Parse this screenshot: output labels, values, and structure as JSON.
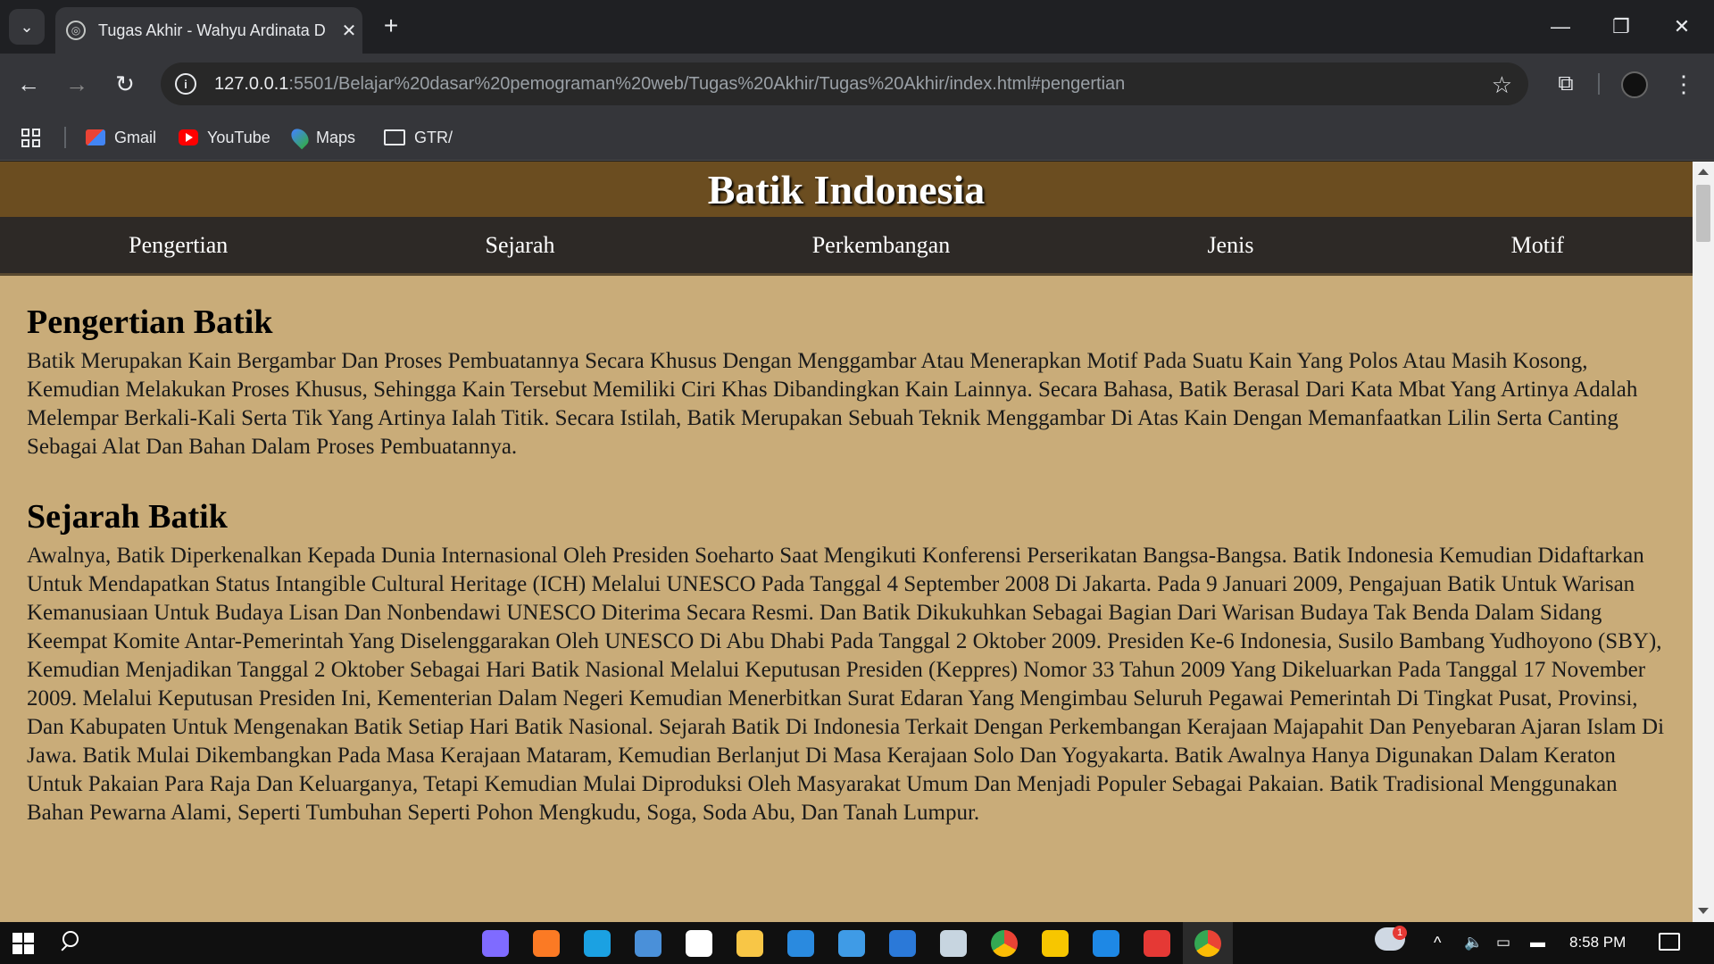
{
  "browser": {
    "tab_title": "Tugas Akhir - Wahyu Ardinata D",
    "url_host": "127.0.0.1",
    "url_path": ":5501/Belajar%20dasar%20pemograman%20web/Tugas%20Akhir/Tugas%20Akhir/index.html#pengertian",
    "bookmarks": [
      {
        "label": "Gmail",
        "icon": "gmail-icon",
        "color": "#ea4335"
      },
      {
        "label": "YouTube",
        "icon": "youtube-icon",
        "color": "#ff0000"
      },
      {
        "label": "Maps",
        "icon": "maps-icon",
        "color": "#34a853"
      },
      {
        "label": "GTR/",
        "icon": "folder-icon",
        "color": "#e8eaed"
      }
    ]
  },
  "site": {
    "title": "Batik Indonesia",
    "nav": [
      "Pengertian",
      "Sejarah",
      "Perkembangan",
      "Jenis",
      "Motif"
    ],
    "sections": [
      {
        "heading": "Pengertian Batik",
        "body": "Batik Merupakan Kain Bergambar Dan Proses Pembuatannya Secara Khusus Dengan Menggambar Atau Menerapkan Motif Pada Suatu Kain Yang Polos Atau Masih Kosong, Kemudian Melakukan Proses Khusus, Sehingga Kain Tersebut Memiliki Ciri Khas Dibandingkan Kain Lainnya. Secara Bahasa, Batik Berasal Dari Kata Mbat Yang Artinya Adalah Melempar Berkali-Kali Serta Tik Yang Artinya Ialah Titik. Secara Istilah, Batik Merupakan Sebuah Teknik Menggambar Di Atas Kain Dengan Memanfaatkan Lilin Serta Canting Sebagai Alat Dan Bahan Dalam Proses Pembuatannya."
      },
      {
        "heading": "Sejarah Batik",
        "body": "Awalnya, Batik Diperkenalkan Kepada Dunia Internasional Oleh Presiden Soeharto Saat Mengikuti Konferensi Perserikatan Bangsa-Bangsa. Batik Indonesia Kemudian Didaftarkan Untuk Mendapatkan Status Intangible Cultural Heritage (ICH) Melalui UNESCO Pada Tanggal 4 September 2008 Di Jakarta. Pada 9 Januari 2009, Pengajuan Batik Untuk Warisan Kemanusiaan Untuk Budaya Lisan Dan Nonbendawi UNESCO Diterima Secara Resmi. Dan Batik Dikukuhkan Sebagai Bagian Dari Warisan Budaya Tak Benda Dalam Sidang Keempat Komite Antar-Pemerintah Yang Diselenggarakan Oleh UNESCO Di Abu Dhabi Pada Tanggal 2 Oktober 2009. Presiden Ke-6 Indonesia, Susilo Bambang Yudhoyono (SBY), Kemudian Menjadikan Tanggal 2 Oktober Sebagai Hari Batik Nasional Melalui Keputusan Presiden (Keppres) Nomor 33 Tahun 2009 Yang Dikeluarkan Pada Tanggal 17 November 2009. Melalui Keputusan Presiden Ini, Kementerian Dalam Negeri Kemudian Menerbitkan Surat Edaran Yang Mengimbau Seluruh Pegawai Pemerintah Di Tingkat Pusat, Provinsi, Dan Kabupaten Untuk Mengenakan Batik Setiap Hari Batik Nasional. Sejarah Batik Di Indonesia Terkait Dengan Perkembangan Kerajaan Majapahit Dan Penyebaran Ajaran Islam Di Jawa. Batik Mulai Dikembangkan Pada Masa Kerajaan Mataram, Kemudian Berlanjut Di Masa Kerajaan Solo Dan Yogyakarta. Batik Awalnya Hanya Digunakan Dalam Keraton Untuk Pakaian Para Raja Dan Keluarganya, Tetapi Kemudian Mulai Diproduksi Oleh Masyarakat Umum Dan Menjadi Populer Sebagai Pakaian. Batik Tradisional Menggunakan Bahan Pewarna Alami, Seperti Tumbuhan Seperti Pohon Mengkudu, Soga, Soda Abu, Dan Tanah Lumpur."
      }
    ]
  },
  "taskbar": {
    "time": "8:58 PM",
    "weather_badge": "1",
    "apps": [
      {
        "name": "copilot-icon",
        "color": "#7f6bff"
      },
      {
        "name": "xampp-icon",
        "color": "#fb7a24"
      },
      {
        "name": "edge-icon",
        "color": "#1ba1e2"
      },
      {
        "name": "sublime-icon",
        "color": "#4a90d9"
      },
      {
        "name": "capcut-icon",
        "color": "#ffffff"
      },
      {
        "name": "file-explorer-icon",
        "color": "#f8c646"
      },
      {
        "name": "vscode-icon",
        "color": "#2a8adf"
      },
      {
        "name": "paint-icon",
        "color": "#3f9be6"
      },
      {
        "name": "store-icon",
        "color": "#2b79d8"
      },
      {
        "name": "steam-icon",
        "color": "#c7d5e0"
      },
      {
        "name": "chrome-icon",
        "color": "#fbbc05"
      },
      {
        "name": "bandicam-icon",
        "color": "#f7c600"
      },
      {
        "name": "play-icon",
        "color": "#1e88e5"
      },
      {
        "name": "wps-icon",
        "color": "#e53935"
      },
      {
        "name": "chrome-active-icon",
        "color": "#fbbc05"
      }
    ]
  }
}
